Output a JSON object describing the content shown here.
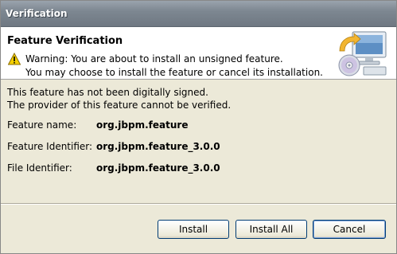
{
  "window": {
    "title": "Verification"
  },
  "banner": {
    "heading": "Feature Verification",
    "warning_line1": "Warning: You are about to install an unsigned feature.",
    "warning_line2": "You may choose to install the feature or cancel its installation.",
    "warning_icon": "warning-triangle-icon",
    "image_icon": "install-disc-computer-icon"
  },
  "body": {
    "line1": "This feature has not been digitally signed.",
    "line2": "The provider of this feature cannot be verified."
  },
  "fields": [
    {
      "label": "Feature name:",
      "value": "org.jbpm.feature"
    },
    {
      "label": "Feature Identifier:",
      "value": "org.jbpm.feature_3.0.0"
    },
    {
      "label": "File Identifier:",
      "value": "org.jbpm.feature_3.0.0"
    }
  ],
  "buttons": {
    "install": "Install",
    "install_all": "Install All",
    "cancel": "Cancel"
  }
}
